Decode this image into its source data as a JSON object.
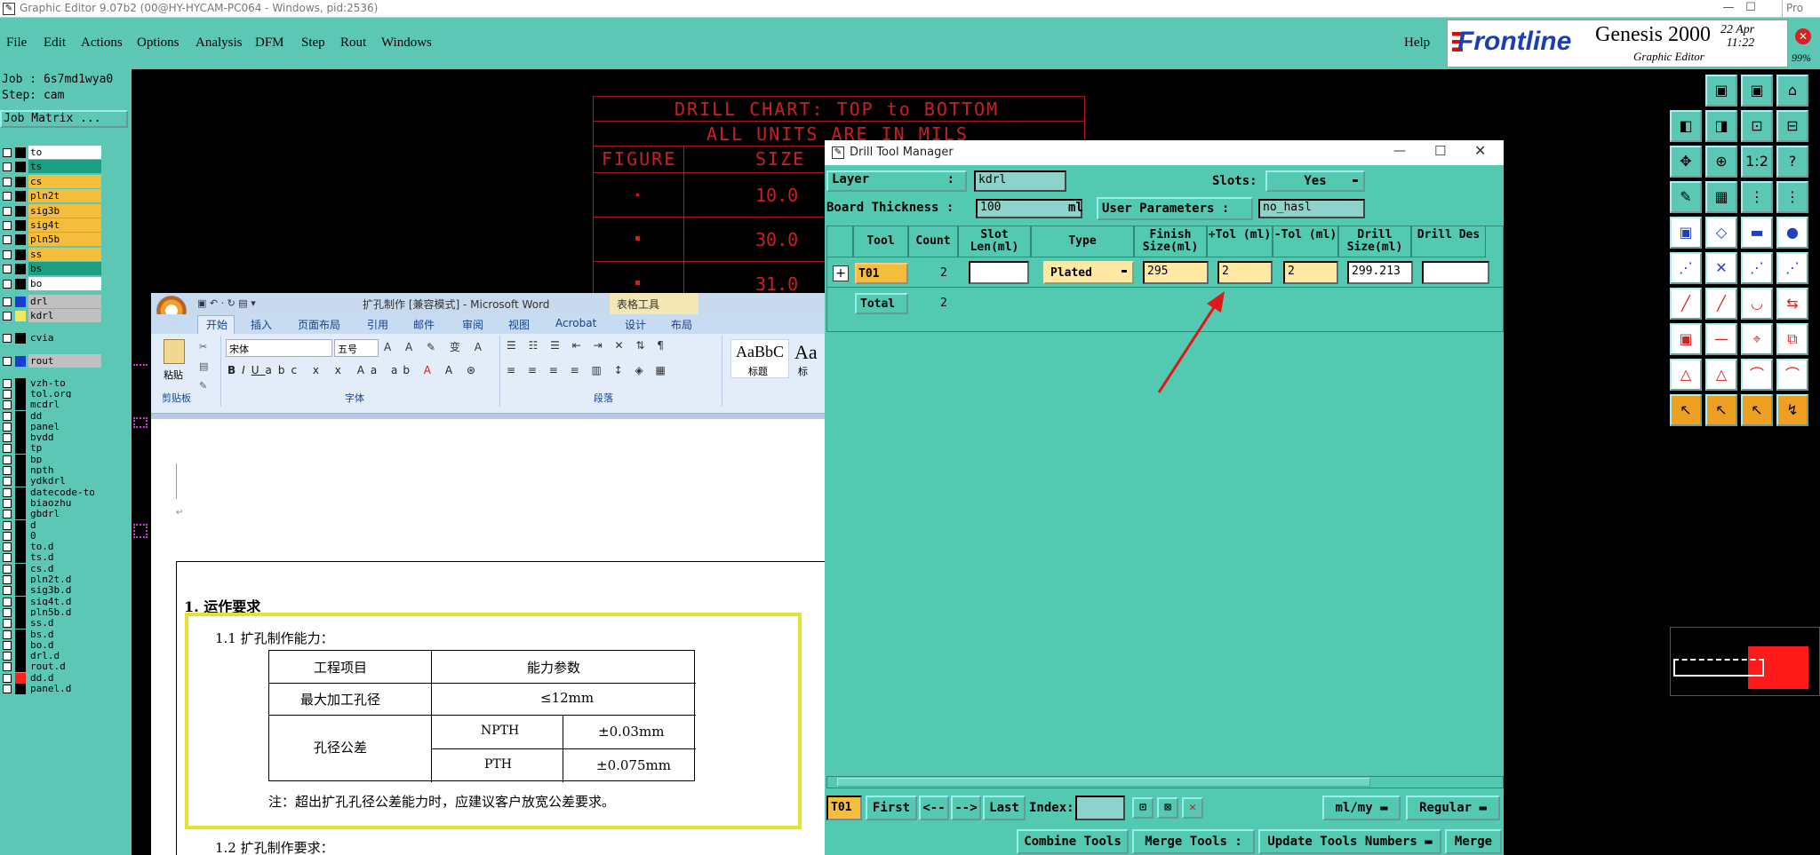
{
  "titlebar": {
    "title": "Graphic Editor 9.07b2 (00@HY-HYCAM-PC064 - Windows, pid:2536)",
    "right_frag": "Pro"
  },
  "menu": {
    "file": "File",
    "edit": "Edit",
    "actions": "Actions",
    "options": "Options",
    "analysis": "Analysis",
    "dfm": "DFM",
    "step": "Step",
    "rout": "Rout",
    "windows": "Windows",
    "help": "Help"
  },
  "brand": {
    "frontline": "Frontline",
    "genesis": "Genesis 2000",
    "subtitle": "Graphic Editor",
    "date": "22 Apr",
    "time": "11:22",
    "zoom": "99%"
  },
  "left": {
    "job": "Job : 6s7md1wya0",
    "step": "Step: cam",
    "job_matrix": "Job Matrix ...",
    "layers": [
      {
        "name": "to",
        "color": "#ffffff"
      },
      {
        "name": "ts",
        "color": "#1aa080"
      },
      {
        "name": "cs",
        "color": "#f5bd3c"
      },
      {
        "name": "pln2t",
        "color": "#f5bd3c"
      },
      {
        "name": "sig3b",
        "color": "#f5bd3c"
      },
      {
        "name": "sig4t",
        "color": "#f5bd3c"
      },
      {
        "name": "pln5b",
        "color": "#f5bd3c"
      },
      {
        "name": "ss",
        "color": "#f5bd3c"
      },
      {
        "name": "bs",
        "color": "#1aa080"
      },
      {
        "name": "bo",
        "color": "#ffffff"
      },
      {
        "name": "drl",
        "color": "#c0c0c0"
      },
      {
        "name": "kdrl",
        "color": "#c0c0c0"
      },
      {
        "name": "cvia",
        "color": "#5cc7b5"
      },
      {
        "name": "rout",
        "color": "#c0c0c0"
      },
      {
        "name": "vzh-to",
        "color": "#5cc7b5"
      },
      {
        "name": "tol.org",
        "color": "#5cc7b5"
      },
      {
        "name": "mcdrl",
        "color": "#5cc7b5"
      },
      {
        "name": "dd",
        "color": "#5cc7b5"
      },
      {
        "name": "panel",
        "color": "#5cc7b5"
      },
      {
        "name": "bydd",
        "color": "#5cc7b5"
      },
      {
        "name": "tp",
        "color": "#5cc7b5"
      },
      {
        "name": "bp",
        "color": "#5cc7b5"
      },
      {
        "name": "npth",
        "color": "#5cc7b5"
      },
      {
        "name": "ydkdrl",
        "color": "#5cc7b5"
      },
      {
        "name": "datecode-to",
        "color": "#5cc7b5"
      },
      {
        "name": "biaozhu",
        "color": "#5cc7b5"
      },
      {
        "name": "gbdrl",
        "color": "#5cc7b5"
      },
      {
        "name": "d",
        "color": "#5cc7b5"
      },
      {
        "name": "0",
        "color": "#5cc7b5"
      },
      {
        "name": "to.d",
        "color": "#5cc7b5"
      },
      {
        "name": "ts.d",
        "color": "#5cc7b5"
      },
      {
        "name": "cs.d",
        "color": "#5cc7b5"
      },
      {
        "name": "pln2t.d",
        "color": "#5cc7b5"
      },
      {
        "name": "sig3b.d",
        "color": "#5cc7b5"
      },
      {
        "name": "sig4t.d",
        "color": "#5cc7b5"
      },
      {
        "name": "pln5b.d",
        "color": "#5cc7b5"
      },
      {
        "name": "ss.d",
        "color": "#5cc7b5"
      },
      {
        "name": "bs.d",
        "color": "#5cc7b5"
      },
      {
        "name": "bo.d",
        "color": "#5cc7b5"
      },
      {
        "name": "drl.d",
        "color": "#5cc7b5"
      },
      {
        "name": "rout.d",
        "color": "#5cc7b5"
      },
      {
        "name": "dd.d",
        "color": "#5cc7b5"
      },
      {
        "name": "panel.d",
        "color": "#5cc7b5"
      }
    ]
  },
  "drill_chart": {
    "title1": "DRILL CHART: TOP to BOTTOM",
    "title2": "ALL UNITS ARE IN MILS",
    "col_figure": "FIGURE",
    "col_size": "SIZE",
    "sizes": [
      "10.0",
      "30.0",
      "31.0"
    ]
  },
  "word": {
    "title": "扩孔制作 [兼容模式] - Microsoft Word",
    "table_tools": "表格工具",
    "tabs": [
      "开始",
      "插入",
      "页面布局",
      "引用",
      "邮件",
      "审阅",
      "视图",
      "Acrobat",
      "设计",
      "布局"
    ],
    "paste": "粘贴",
    "font_name": "宋体",
    "font_size": "五号",
    "style_sample": "AaBbC",
    "style_label": "标题",
    "style_sample2": "Aa",
    "style_label2": "标",
    "groups": [
      "剪贴板",
      "字体",
      "段落"
    ],
    "heading": "1.   运作要求",
    "sub1": "1.1 扩孔制作能力：",
    "table": {
      "h1": "工程项目",
      "h2": "能力参数",
      "r1c1": "最大加工孔径",
      "r1c2": "≤12mm",
      "r2c1": "孔径公差",
      "r2a": "NPTH",
      "r2b": "±0.03mm",
      "r3a": "PTH",
      "r3b": "±0.075mm"
    },
    "note": "注：超出扩孔孔径公差能力时，应建议客户放宽公差要求。",
    "sub2": "1.2 扩孔制作要求："
  },
  "dtm": {
    "title": "Drill Tool Manager",
    "layer_label": "Layer",
    "layer_value": "kdrl",
    "slots_label": "Slots:",
    "slots_value": "Yes",
    "thickness_label": "Board Thickness :",
    "thickness_value": "100",
    "thickness_unit": "ml",
    "user_params_label": "User Parameters :",
    "user_params_value": "no_hasl",
    "headers": [
      "Tool",
      "Count",
      "Slot Len(ml)",
      "Type",
      "Finish Size(ml)",
      "+Tol (ml)",
      "-Tol (ml)",
      "Drill Size(ml)",
      "Drill Des"
    ],
    "row": {
      "tool": "T01",
      "count": "2",
      "type": "Plated",
      "finish": "295",
      "ptol": "2",
      "ntol": "2",
      "drill": "299.213"
    },
    "total_label": "Total",
    "total_count": "2",
    "current_tool": "T01",
    "first": "First",
    "prev": "<--",
    "next": "-->",
    "last": "Last",
    "index_label": "Index:",
    "units": "ml/my",
    "mode": "Regular",
    "combine": "Combine Tools",
    "merge_tools": "Merge Tools :",
    "update_numbers": "Update Tools Numbers",
    "merge": "Merge"
  }
}
